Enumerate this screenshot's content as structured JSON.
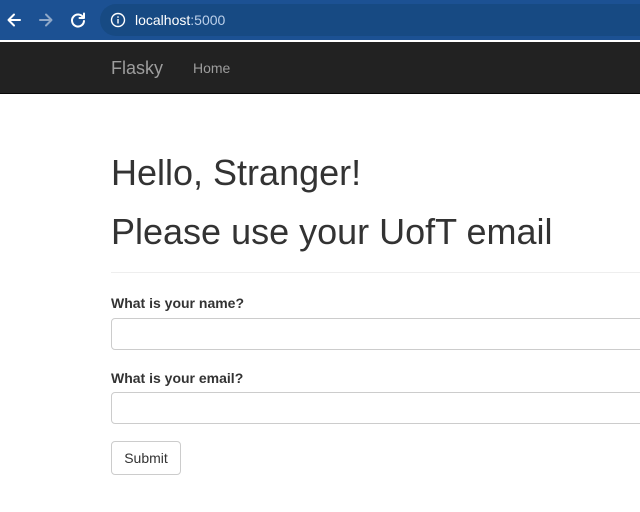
{
  "browser": {
    "url_host": "localhost",
    "url_port": ":5000",
    "icons": [
      "back-arrow-icon",
      "forward-arrow-icon",
      "reload-icon",
      "site-info-icon"
    ],
    "colors": {
      "toolbar": "#1c5193",
      "omnibox": "#174a83"
    }
  },
  "navbar": {
    "brand": "Flasky",
    "items": [
      {
        "label": "Home"
      }
    ],
    "colors": {
      "background": "#222222",
      "text": "#9d9d9d"
    }
  },
  "main": {
    "greeting": "Hello, Stranger!",
    "subtitle": "Please use your UofT email"
  },
  "form": {
    "name_label": "What is your name?",
    "name_value": "",
    "email_label": "What is your email?",
    "email_value": "",
    "submit_label": "Submit"
  }
}
